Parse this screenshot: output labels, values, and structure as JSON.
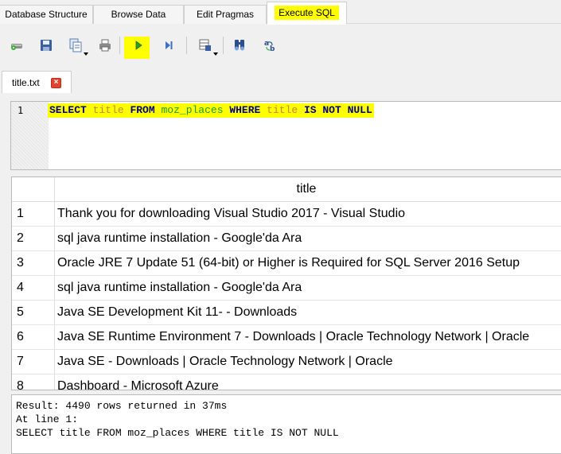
{
  "main_tabs": [
    {
      "label": "Database Structure"
    },
    {
      "label": "Browse Data"
    },
    {
      "label": "Edit Pragmas"
    },
    {
      "label": "Execute SQL",
      "active": true
    }
  ],
  "toolbar": {
    "icons": [
      "open-tab-icon",
      "save-icon",
      "copy-icon",
      "print-icon",
      "execute-all-icon",
      "execute-line-icon",
      "save-results-icon",
      "find-icon",
      "find-replace-icon"
    ]
  },
  "editor_tab": {
    "label": "title.txt"
  },
  "editor": {
    "line_number": "1",
    "tokens": [
      {
        "text": "SELECT",
        "kind": "kw"
      },
      {
        "text": " ",
        "kind": "sp"
      },
      {
        "text": "title",
        "kind": "id"
      },
      {
        "text": " ",
        "kind": "sp"
      },
      {
        "text": "FROM",
        "kind": "kw"
      },
      {
        "text": " ",
        "kind": "sp"
      },
      {
        "text": "moz_places",
        "kind": "tbl"
      },
      {
        "text": " ",
        "kind": "sp"
      },
      {
        "text": "WHERE",
        "kind": "kw"
      },
      {
        "text": " ",
        "kind": "sp"
      },
      {
        "text": "title",
        "kind": "id"
      },
      {
        "text": " ",
        "kind": "sp"
      },
      {
        "text": "IS NOT NULL",
        "kind": "kw"
      }
    ]
  },
  "results": {
    "column": "title",
    "rows": [
      {
        "num": "1",
        "title": "Thank you for downloading Visual Studio 2017 - Visual Studio"
      },
      {
        "num": "2",
        "title": "sql java runtime installation - Google'da Ara"
      },
      {
        "num": "3",
        "title": "Oracle JRE 7 Update 51 (64-bit) or Higher is Required for SQL Server 2016 Setup"
      },
      {
        "num": "4",
        "title": "sql java runtime installation - Google'da Ara"
      },
      {
        "num": "5",
        "title": "Java SE Development Kit 11- - Downloads"
      },
      {
        "num": "6",
        "title": "Java SE Runtime Environment 7 - Downloads | Oracle Technology Network | Oracle"
      },
      {
        "num": "7",
        "title": "Java SE - Downloads | Oracle Technology Network | Oracle"
      },
      {
        "num": "8",
        "title": "Dashboard - Microsoft Azure"
      }
    ]
  },
  "message": {
    "line1": "Result: 4490 rows returned in 37ms",
    "line2": "At line 1:",
    "line3": "SELECT title FROM moz_places WHERE title IS NOT NULL"
  },
  "colors": {
    "highlight": "#ffff00",
    "keyword": "#000080",
    "identifier": "#c8872d",
    "table": "#1d9b2a"
  }
}
